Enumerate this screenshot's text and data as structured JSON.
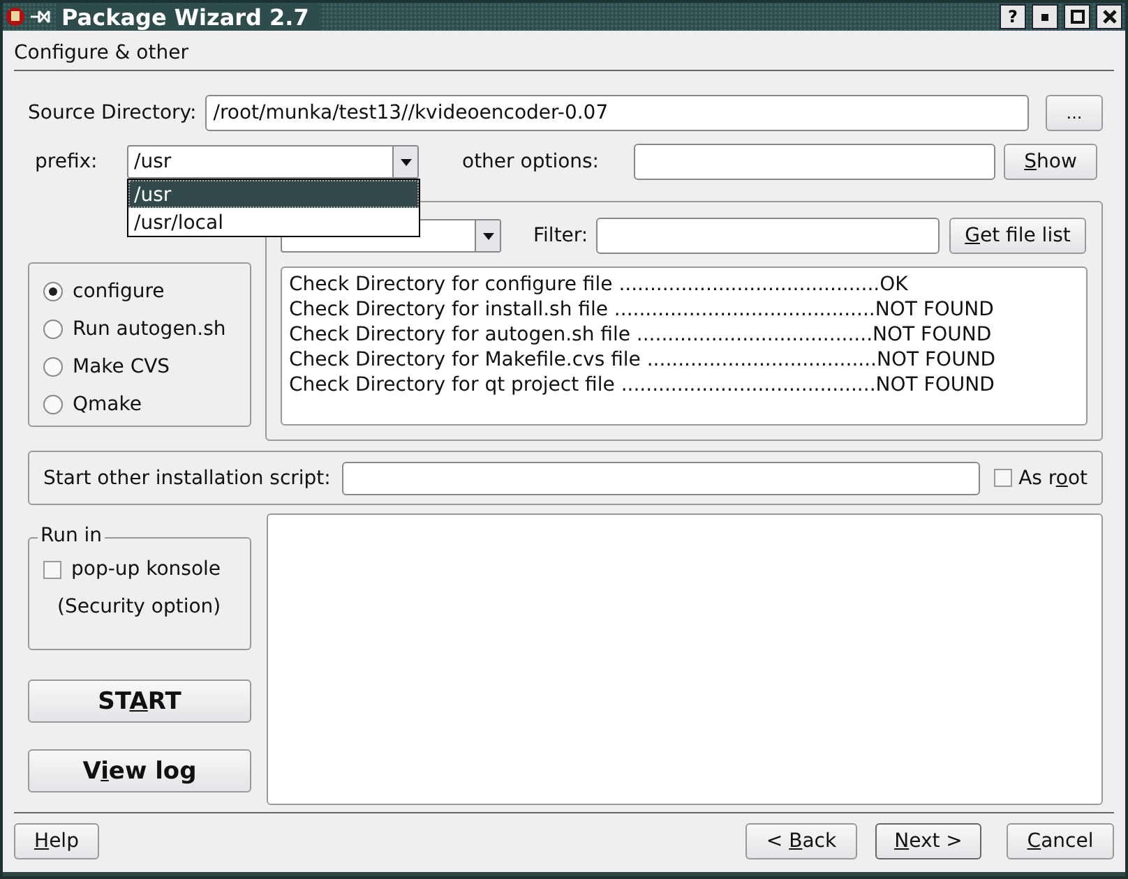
{
  "window": {
    "title": "Package Wizard 2.7",
    "help_button": "?"
  },
  "page_title": "Configure & other",
  "source_directory": {
    "label": "Source Directory:",
    "value": "/root/munka/test13//kvideoencoder-0.07",
    "browse_button": "..."
  },
  "prefix": {
    "label": "prefix:",
    "value": "/usr",
    "expanded": true,
    "options": [
      {
        "label": "/usr",
        "selected": true
      },
      {
        "label": "/usr/local",
        "selected": false
      }
    ]
  },
  "other_options": {
    "label": "other options:",
    "button": {
      "key": "S",
      "after": "how"
    }
  },
  "check": {
    "filter_label": "Filter:",
    "button": {
      "key": "G",
      "after": "et file list"
    },
    "log": [
      {
        "text": "Check Directory for configure file ..........................................",
        "result": "OK"
      },
      {
        "text": "Check Directory for install.sh file ..........................................",
        "result": "NOT FOUND"
      },
      {
        "text": "Check Directory for autogen.sh file ......................................",
        "result": "NOT FOUND"
      },
      {
        "text": "Check Directory for Makefile.cvs file .....................................",
        "result": "NOT FOUND"
      },
      {
        "text": "Check Directory for qt project file .........................................",
        "result": "NOT FOUND"
      }
    ]
  },
  "build_methods": [
    {
      "label": "configure",
      "selected": true
    },
    {
      "label": "Run autogen.sh",
      "selected": false
    },
    {
      "label": "Make CVS",
      "selected": false
    },
    {
      "label": "Qmake",
      "selected": false
    }
  ],
  "script": {
    "label": "Start other installation script:",
    "as_root": {
      "label": {
        "before": "As r",
        "key": "o",
        "after": "ot"
      },
      "checked": false
    }
  },
  "run_in": {
    "title": "Run in",
    "konsole": {
      "label": "pop-up konsole",
      "checked": false
    },
    "note": "(Security option)"
  },
  "start_button": {
    "before": "ST",
    "key": "A",
    "after": "RT"
  },
  "view_log_button": {
    "before": "V",
    "key": "i",
    "after": "ew log"
  },
  "footer": {
    "help": {
      "key": "H",
      "after": "elp"
    },
    "back": {
      "before": "< ",
      "key": "B",
      "after": "ack"
    },
    "next": {
      "key": "N",
      "after": "ext >"
    },
    "cancel": {
      "key": "C",
      "after": "ancel"
    }
  }
}
